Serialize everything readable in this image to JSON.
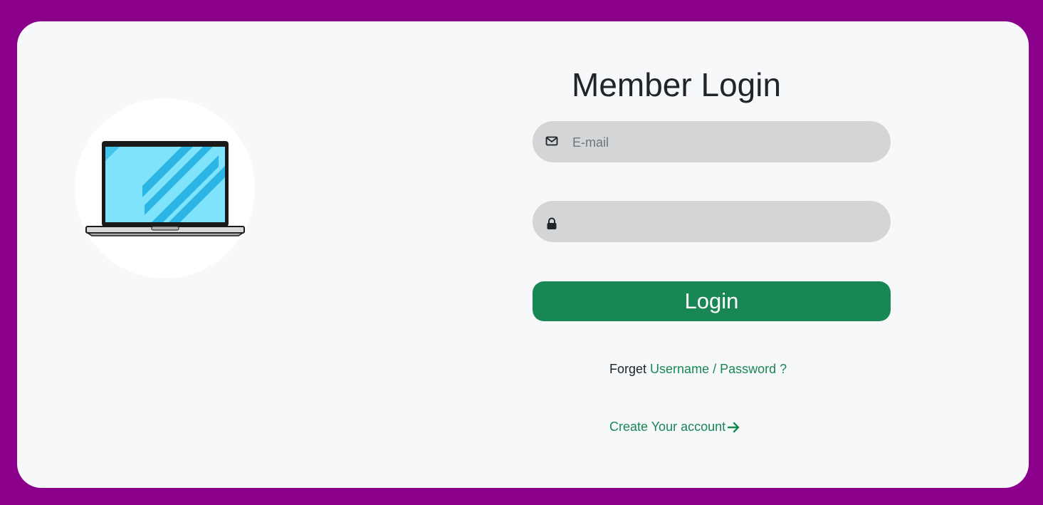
{
  "login": {
    "title": "Member Login",
    "email_placeholder": "E-mail",
    "password_placeholder": "",
    "login_label": "Login",
    "forgot_prefix": "Forget",
    "forgot_link": "Username / Password ?",
    "create_account": "Create Your account"
  },
  "icons": {
    "email": "envelope-icon",
    "password": "lock-icon",
    "create": "arrow-right-icon",
    "illustration": "laptop-icon"
  },
  "colors": {
    "background": "#8b008b",
    "card": "#f7f8fa",
    "field": "#d4d5d7",
    "accent": "#198754",
    "screen": "#7fe3fb"
  }
}
